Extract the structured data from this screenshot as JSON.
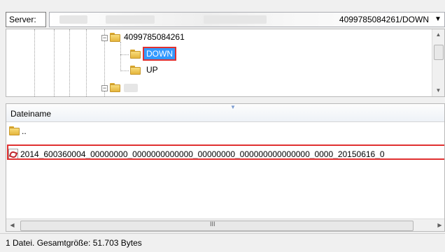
{
  "server": {
    "label": "Server:",
    "path_visible": "4099785084261/DOWN",
    "dropdown_icon": "chevron-down-icon"
  },
  "tree": {
    "items": [
      {
        "label": "4099785084261",
        "icon": "folder-icon",
        "expanded": true
      },
      {
        "label": "DOWN",
        "icon": "folder-icon",
        "selected": true
      },
      {
        "label": "UP",
        "icon": "folder-icon"
      },
      {
        "label": "",
        "icon": "folder-icon",
        "expanded": true
      }
    ]
  },
  "filelist": {
    "column_header": "Dateiname",
    "rows": [
      {
        "name": "..",
        "icon": "folder-icon"
      },
      {
        "name": "2014_600360004_00000000_0000000000000_00000000_000000000000000_0000_20150616_0",
        "icon": "pdf-icon"
      }
    ],
    "scrollbar_grip": "III"
  },
  "status": {
    "text": "1 Datei. Gesamtgröße: 51.703 Bytes"
  },
  "colors": {
    "selection": "#3399ff",
    "highlight": "#e03030"
  }
}
